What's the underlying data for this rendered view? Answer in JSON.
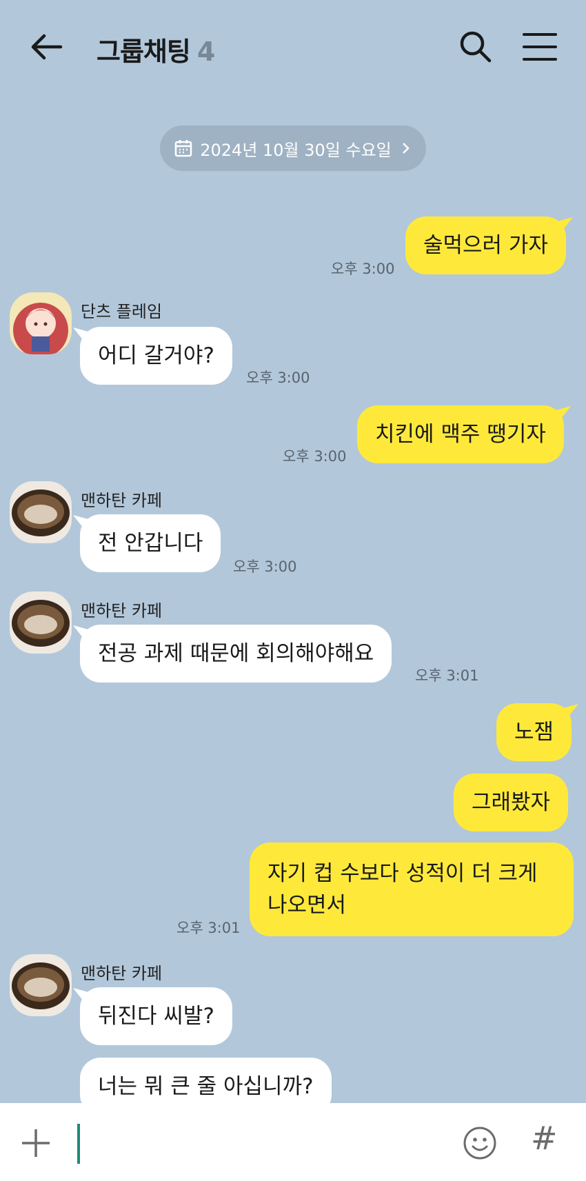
{
  "header": {
    "title": "그룹채팅",
    "member_count": "4",
    "back_icon": "arrow-left-icon",
    "search_icon": "search-icon",
    "menu_icon": "hamburger-menu-icon"
  },
  "date_divider": {
    "icon": "calendar-icon",
    "label": "2024년 10월 30일 수요일",
    "chevron": "chevron-right-icon"
  },
  "messages": [
    {
      "sender": "me",
      "text": "술먹으러 가자",
      "time": "오후 3:00"
    },
    {
      "sender": "단츠 플레임",
      "text": "어디 갈거야?",
      "time": "오후 3:00"
    },
    {
      "sender": "me",
      "text": "치킨에 맥주 땡기자",
      "time": "오후 3:00"
    },
    {
      "sender": "맨하탄 카페",
      "text": "전 안갑니다",
      "time": "오후 3:00"
    },
    {
      "sender": "맨하탄 카페",
      "text": "전공 과제 때문에 회의해야해요",
      "time": "오후 3:01"
    },
    {
      "sender": "me",
      "text": "노잼",
      "time": ""
    },
    {
      "sender": "me",
      "text": "그래봤자",
      "time": ""
    },
    {
      "sender": "me",
      "text": "자기 컵 수보다 성적이 더 크게",
      "text2": "나오면서",
      "time": "오후 3:01"
    },
    {
      "sender": "맨하탄 카페",
      "text": "뒤진다 씨발?",
      "time": ""
    },
    {
      "sender": "맨하탄 카페",
      "text": "너는 뭐 큰 줄 아십니까?",
      "time": ""
    }
  ],
  "input_bar": {
    "plus_icon": "plus-icon",
    "emoji_icon": "emoji-icon",
    "hash_icon": "#"
  },
  "colors": {
    "background": "#b2c7da",
    "my_bubble": "#fee93b",
    "other_bubble": "#ffffff",
    "cursor": "#1f8a78"
  }
}
